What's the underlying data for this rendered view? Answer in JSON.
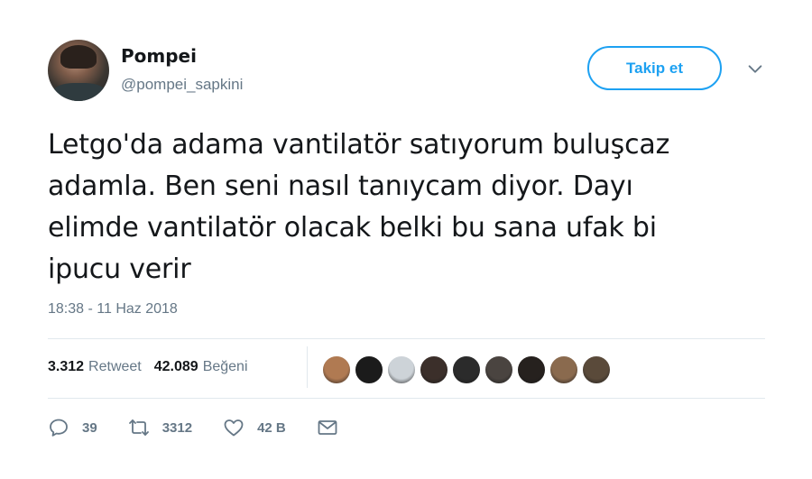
{
  "author": {
    "name": "Pompei",
    "handle": "@pompei_sapkini"
  },
  "follow_button": {
    "label": "Takip et"
  },
  "tweet": {
    "lines": [
      "Letgo'da adama vantilatör satıyorum buluşcaz",
      "adamla. Ben seni nasıl tanıycam diyor. Dayı",
      "elimde vantilatör olacak belki bu sana ufak bi",
      "ipucu verir"
    ],
    "timestamp": "18:38 - 11 Haz 2018"
  },
  "stats": {
    "retweet_count": "3.312",
    "retweet_label": "Retweet",
    "like_count": "42.089",
    "like_label": "Beğeni"
  },
  "likers": [
    {
      "color": "#b07a52"
    },
    {
      "color": "#1b1b1b"
    },
    {
      "color": "#cdd3d8"
    },
    {
      "color": "#3b2f2a"
    },
    {
      "color": "#2b2b2b"
    },
    {
      "color": "#4a4440"
    },
    {
      "color": "#26211e"
    },
    {
      "color": "#8a6a4e"
    },
    {
      "color": "#5a4a3a"
    }
  ],
  "actions": {
    "reply_count": "39",
    "retweet_count": "3312",
    "like_count": "42 B"
  },
  "colors": {
    "accent": "#1da1f2",
    "text": "#14171a",
    "muted": "#657786",
    "divider": "#e1e8ed"
  }
}
